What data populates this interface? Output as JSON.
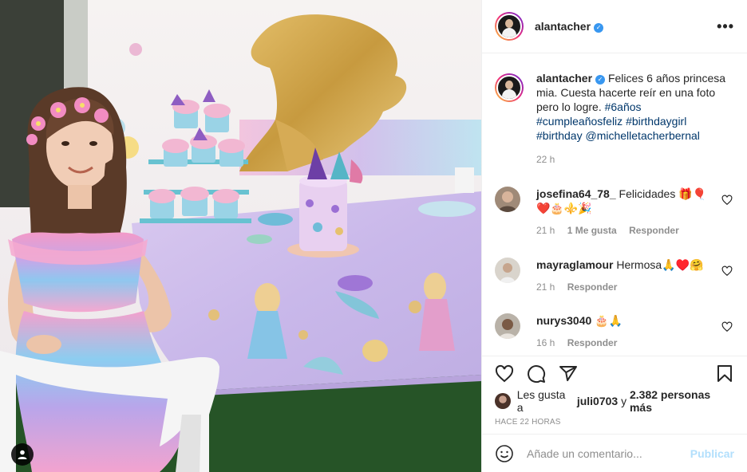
{
  "post": {
    "username": "alantacher",
    "more_icon": "more-horizontal-icon",
    "caption_lines": [
      "Felices 6 años princesa",
      "mia. Cuesta hacerte reír en una foto",
      "pero lo logre."
    ],
    "hashtags": [
      "#6años",
      "#cumpleañosfeliz",
      "#birthdaygirl",
      "#birthday"
    ],
    "mention": "@michelletacherbernal",
    "caption_time": "22 h"
  },
  "comments": [
    {
      "username": "josefina64_78_",
      "text": "Felicidades 🎁🎈",
      "emoji_line": "❤️🎂⚜️🎉",
      "time": "21 h",
      "likes": "1 Me gusta",
      "reply": "Responder"
    },
    {
      "username": "mayraglamour",
      "text": "Hermosa🙏♥️🤗",
      "time": "21 h",
      "reply": "Responder"
    },
    {
      "username": "nurys3040",
      "text": "🎂🙏",
      "time": "16 h",
      "reply": "Responder"
    }
  ],
  "likes": {
    "prefix": "Les gusta a",
    "user": "juli0703",
    "conj": "y",
    "count": "2.382 personas más"
  },
  "ago": "HACE 22 HORAS",
  "comment_box": {
    "placeholder": "Añade un comentario...",
    "publish": "Publicar"
  },
  "colors": {
    "link": "#00376b",
    "verified": "#3897f0",
    "publish": "#b2dffc",
    "meta": "#8e8e8e"
  }
}
